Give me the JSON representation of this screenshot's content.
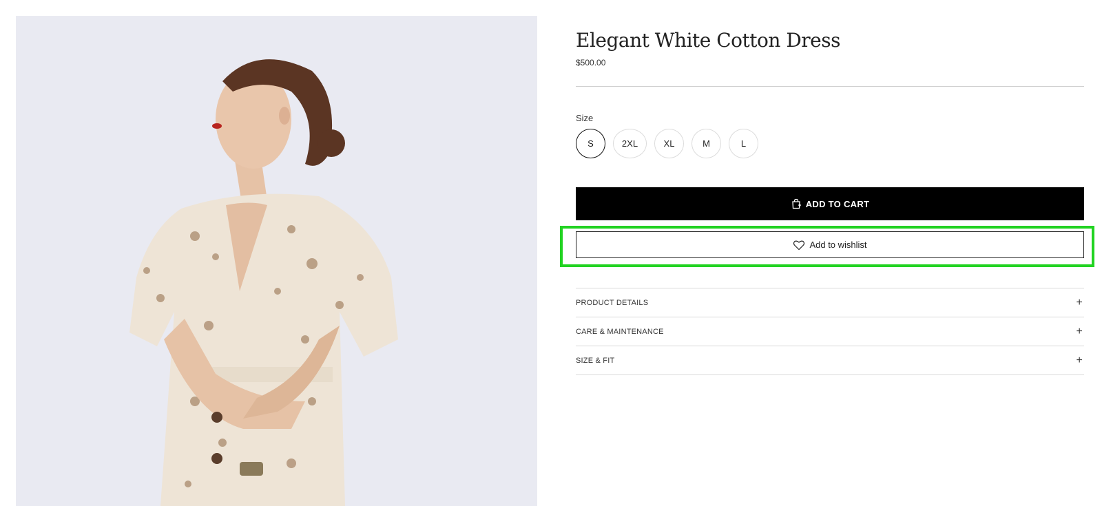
{
  "product": {
    "title": "Elegant White Cotton Dress",
    "price": "$500.00",
    "image_alt": "Woman wearing floral linen wrap dress"
  },
  "size": {
    "label": "Size",
    "options": [
      "S",
      "2XL",
      "XL",
      "M",
      "L"
    ],
    "selected": "S"
  },
  "actions": {
    "add_to_cart": "ADD TO CART",
    "add_to_wishlist": "Add to wishlist"
  },
  "accordion": [
    {
      "label": "PRODUCT DETAILS",
      "icon": "plus-icon"
    },
    {
      "label": "CARE & MAINTENANCE",
      "icon": "plus-icon"
    },
    {
      "label": "SIZE & FIT",
      "icon": "plus-icon"
    }
  ],
  "colors": {
    "image_bg": "#e9eaf2",
    "highlight": "#22d322",
    "primary_button": "#000000"
  }
}
